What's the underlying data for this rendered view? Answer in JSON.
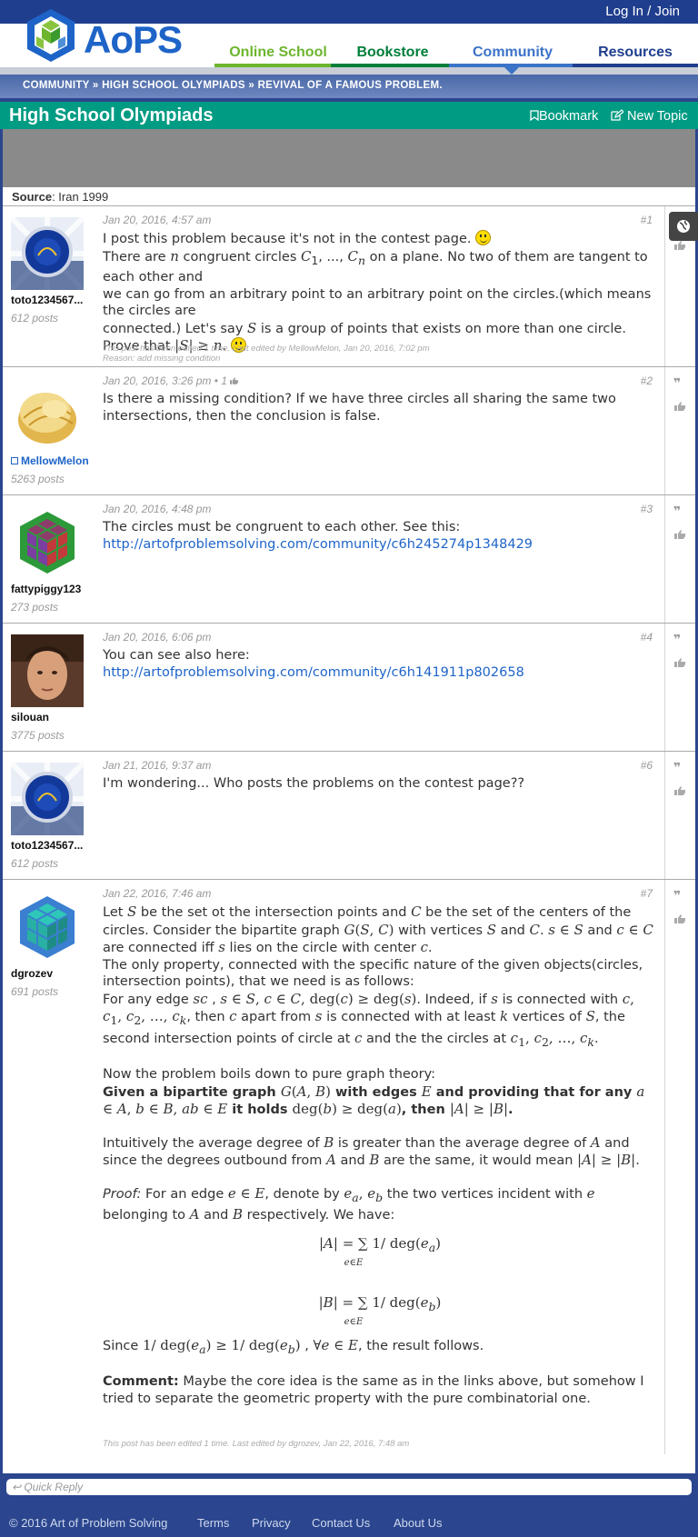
{
  "header": {
    "login": "Log In / Join",
    "logo_text": "AoPS",
    "nav": [
      {
        "label": "Online School",
        "color": "#6cb52d"
      },
      {
        "label": "Bookstore",
        "color": "#007e3a"
      },
      {
        "label": "Community",
        "color": "#3b73c8"
      },
      {
        "label": "Resources",
        "color": "#1f3e8e"
      }
    ]
  },
  "breadcrumb": {
    "items": [
      "COMMUNITY",
      "HIGH SCHOOL OLYMPIADS",
      "REVIVAL OF A FAMOUS PROBLEM."
    ],
    "sep": "»"
  },
  "forum": {
    "title": "High School Olympiads",
    "bookmark": "Bookmark",
    "new_topic": "New Topic"
  },
  "source": {
    "label": "Source",
    "value": ": Iran 1999"
  },
  "posts": [
    {
      "user": "toto1234567...",
      "posts": "612 posts",
      "date": "Jan 20, 2016, 4:57 am",
      "num": "#1",
      "edited": "This post has been edited 1 time. Last edited by MellowMelon, Jan 20, 2016, 7:02 pm",
      "reason": "Reason: add missing condition"
    },
    {
      "user": "MellowMelon",
      "posts": "5263 posts",
      "date": "Jan 20, 2016, 3:26 pm • 1",
      "num": "#2",
      "body": "Is there a missing condition? If we have three circles all sharing the same two intersections, then the conclusion is false."
    },
    {
      "user": "fattypiggy123",
      "posts": "273 posts",
      "date": "Jan 20, 2016, 4:48 pm",
      "num": "#3",
      "body": "The circles must be congruent to each other. See this:",
      "link": "http://artofproblemsolving.com/community/c6h245274p1348429"
    },
    {
      "user": "silouan",
      "posts": "3775 posts",
      "date": "Jan 20, 2016, 6:06 pm",
      "num": "#4",
      "body": "You can see also here:",
      "link": "http://artofproblemsolving.com/community/c6h141911p802658"
    },
    {
      "user": "toto1234567...",
      "posts": "612 posts",
      "date": "Jan 21, 2016, 9:37 am",
      "num": "#6",
      "body": "I'm wondering... Who posts the problems on the contest page??"
    },
    {
      "user": "dgrozev",
      "posts": "691 posts",
      "date": "Jan 22, 2016, 7:46 am",
      "num": "#7",
      "edited": "This post has been edited 1 time. Last edited by dgrozev, Jan 22, 2016, 7:48 am"
    }
  ],
  "quick_reply": "Quick Reply",
  "footer": {
    "copyright": "© 2016 Art of Problem Solving",
    "links": [
      "Terms",
      "Privacy",
      "Contact Us",
      "About Us"
    ]
  }
}
